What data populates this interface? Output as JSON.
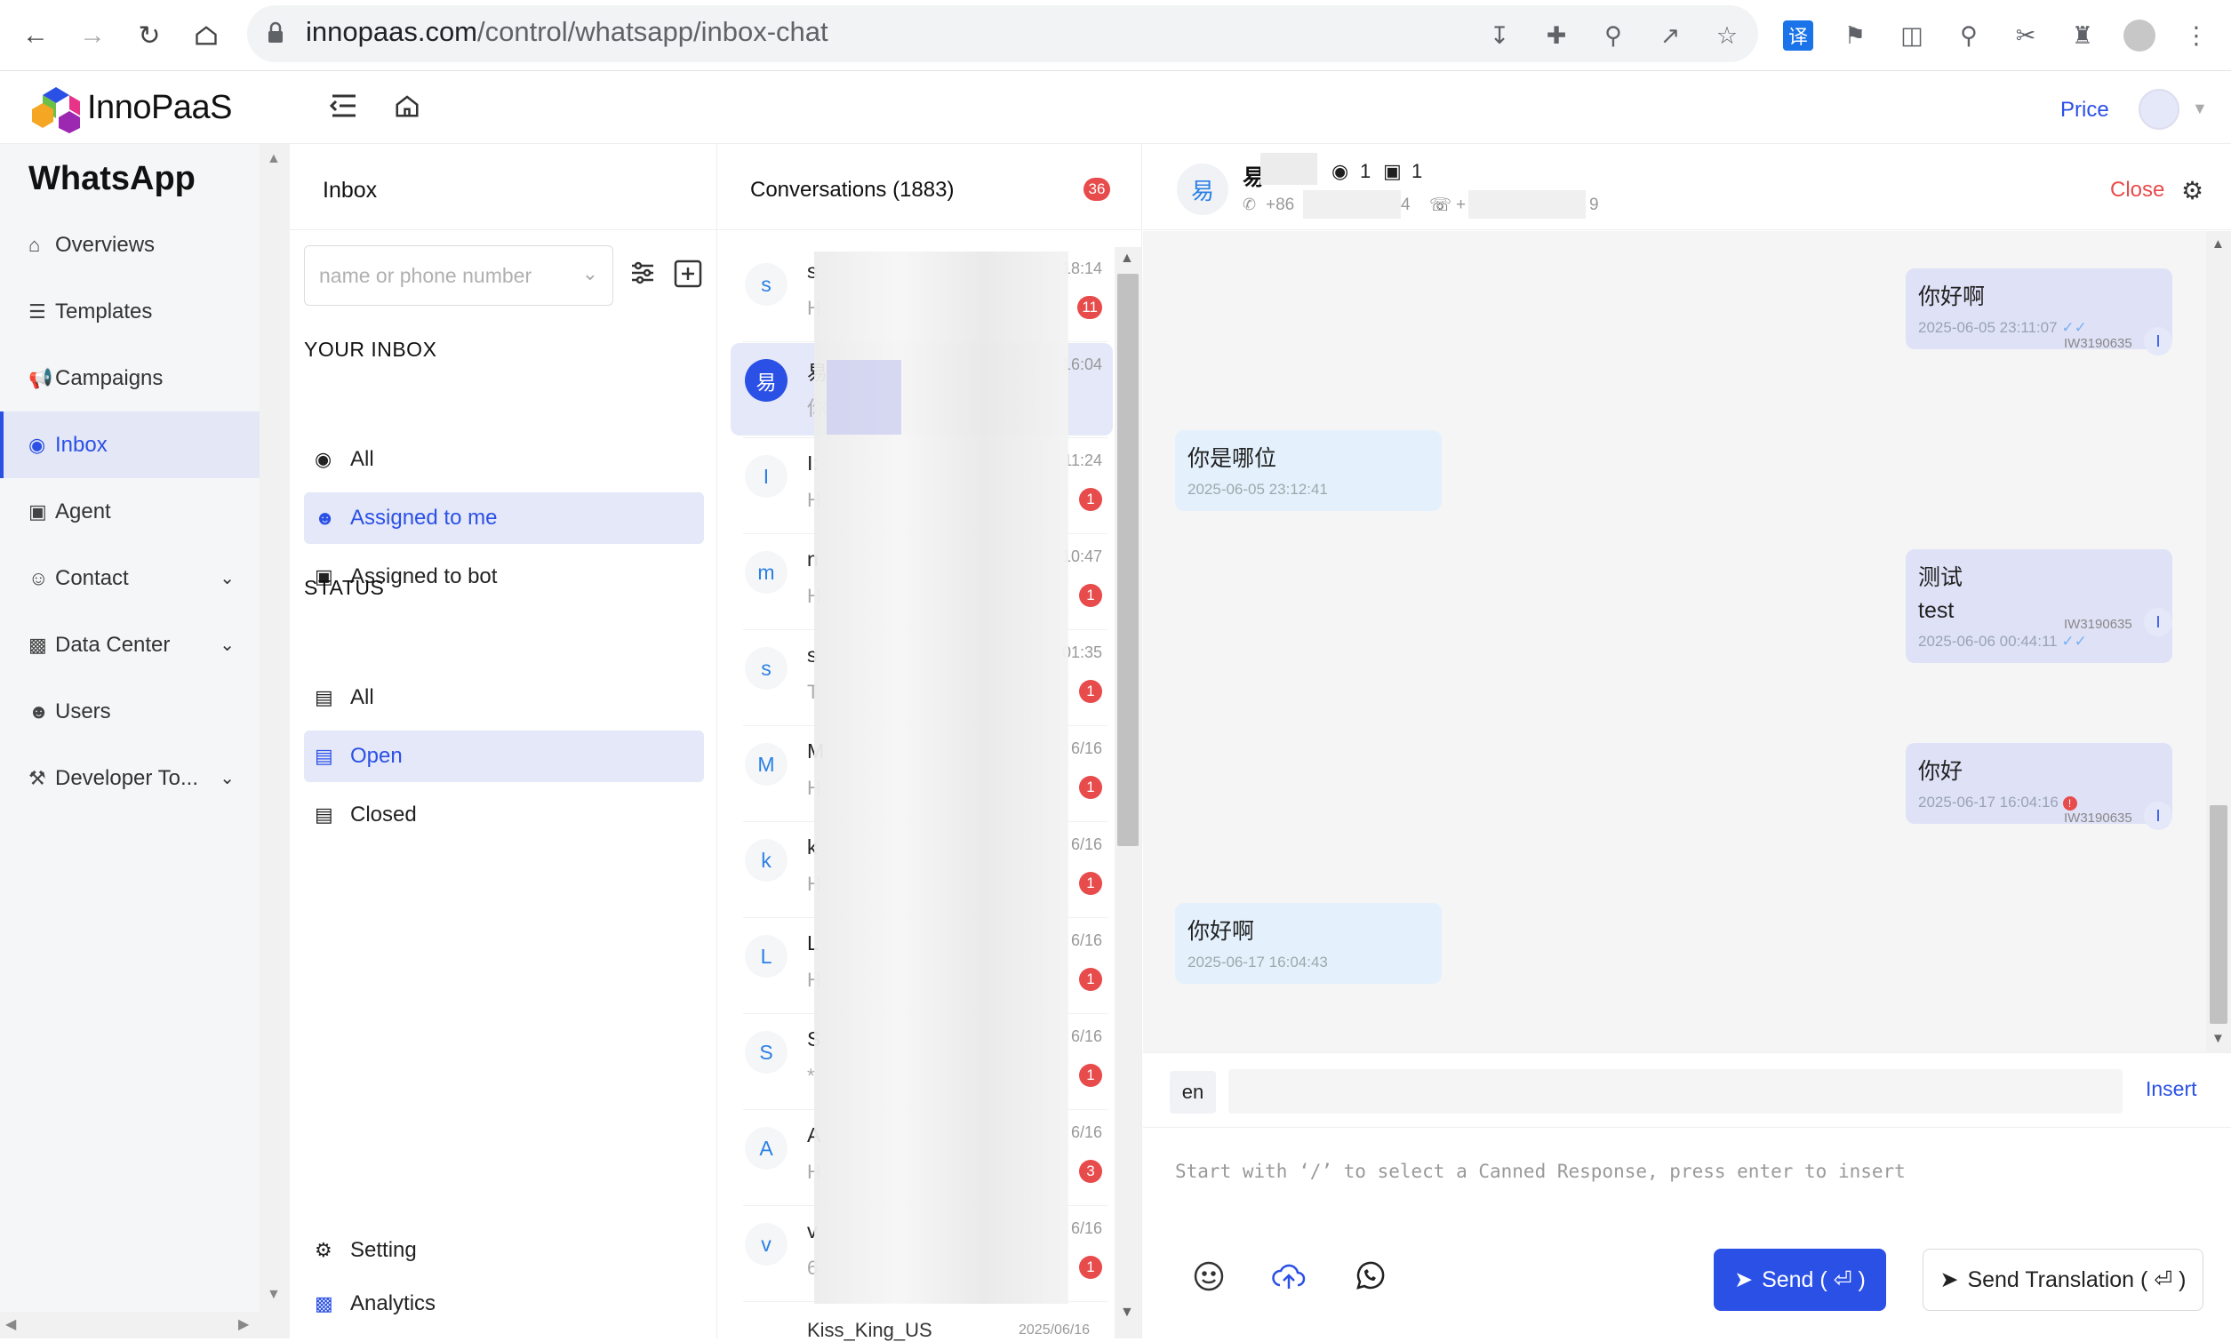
{
  "browser": {
    "url_host": "innopaas.com",
    "url_path": "/control/whatsapp/inbox-chat",
    "ext_translate_label": "译"
  },
  "header": {
    "logo": "InnoPaaS",
    "price": "Price"
  },
  "sidebar": {
    "title": "WhatsApp",
    "items": [
      {
        "label": "Overviews",
        "icon": "home-icon"
      },
      {
        "label": "Templates",
        "icon": "list-icon"
      },
      {
        "label": "Campaigns",
        "icon": "megaphone-icon"
      },
      {
        "label": "Inbox",
        "icon": "chat-icon",
        "active": true
      },
      {
        "label": "Agent",
        "icon": "robot-icon"
      },
      {
        "label": "Contact",
        "icon": "user-icon",
        "expandable": true
      },
      {
        "label": "Data Center",
        "icon": "chart-icon",
        "expandable": true
      },
      {
        "label": "Users",
        "icon": "users-icon"
      },
      {
        "label": "Developer To...",
        "icon": "tools-icon",
        "expandable": true
      }
    ]
  },
  "inbox": {
    "title": "Inbox",
    "search_placeholder": "name or phone number",
    "your_inbox_label": "YOUR INBOX",
    "your_inbox": [
      "All",
      "Assigned to me",
      "Assigned to bot"
    ],
    "status_label": "STATUS",
    "status": [
      "All",
      "Open",
      "Closed"
    ],
    "footer": [
      "Setting",
      "Analytics"
    ]
  },
  "conversations": {
    "title": "Conversations (1883)",
    "unread": "36",
    "rows": [
      {
        "initial": "s",
        "name": "s",
        "preview": "H",
        "time": "18:14",
        "badge": "11"
      },
      {
        "initial": "易",
        "name": "易",
        "preview": "你",
        "time": "16:04",
        "badge": ""
      },
      {
        "initial": "I",
        "name": "I:",
        "preview": "H",
        "time": "11:24",
        "badge": "1"
      },
      {
        "initial": "m",
        "name": "n",
        "preview": "H",
        "time": "10:47",
        "badge": "1"
      },
      {
        "initial": "s",
        "name": "s",
        "preview": "T",
        "time": "01:35",
        "badge": "1"
      },
      {
        "initial": "M",
        "name": "M",
        "preview": "H",
        "time": "6/16",
        "badge": "1"
      },
      {
        "initial": "k",
        "name": "k",
        "preview": "H",
        "time": "6/16",
        "badge": "1"
      },
      {
        "initial": "L",
        "name": "L",
        "preview": "H",
        "time": "6/16",
        "badge": "1"
      },
      {
        "initial": "S",
        "name": "S",
        "preview": "*",
        "time": "6/16",
        "badge": "1"
      },
      {
        "initial": "A",
        "name": "A",
        "preview": "H",
        "time": "6/16",
        "badge": "3"
      },
      {
        "initial": "v",
        "name": "v",
        "preview": "6",
        "time": "6/16",
        "badge": "1"
      }
    ],
    "partial_row_name": "Kiss_King_US",
    "partial_row_time": "2025/06/16"
  },
  "chat": {
    "contact_initial": "易",
    "contact_name": "易",
    "agent_count": "1",
    "bot_count": "1",
    "phone": "+86",
    "phone_tail": "4",
    "wa_prefix": "+",
    "wa_tail": "9",
    "close": "Close",
    "messages": [
      {
        "dir": "out",
        "text": "你好啊",
        "time": "2025-06-05 23:11:07",
        "agent": "IW3190635",
        "status": "read"
      },
      {
        "dir": "in",
        "text": "你是哪位",
        "time": "2025-06-05 23:12:41"
      },
      {
        "dir": "out",
        "text": "测试",
        "text2": "test",
        "time": "2025-06-06 00:44:11",
        "agent": "IW3190635",
        "status": "read"
      },
      {
        "dir": "out",
        "text": "你好",
        "time": "2025-06-17 16:04:16",
        "agent": "IW3190635",
        "status": "error"
      },
      {
        "dir": "in",
        "text": "你好啊",
        "time": "2025-06-17 16:04:43"
      }
    ],
    "agent_badge": "I"
  },
  "composer": {
    "lang": "en",
    "insert": "Insert",
    "placeholder": "Start with ‘/’ to select a Canned Response, press enter to insert",
    "send": "Send ( ⏎ )",
    "send_translation": "Send Translation ( ⏎ )"
  },
  "colors": {
    "accent": "#2b50e6",
    "badge": "#e84b4b"
  }
}
